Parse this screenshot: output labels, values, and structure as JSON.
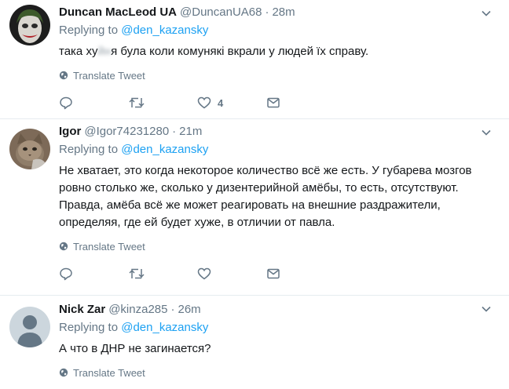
{
  "tweets": [
    {
      "fullname": "Duncan MacLeod UA",
      "handle": "@DuncanUA68",
      "time": "28m",
      "replying_prefix": "Replying to",
      "reply_to": "@den_kazansky",
      "text_before": "така ху",
      "text_hidden": "йн",
      "text_after": "я була коли комунякі вкрали у людей їх справу.",
      "translate": "Translate Tweet",
      "avatar_icon": "joker-avatar",
      "actions": {
        "reply": "",
        "retweet": "",
        "like": "4",
        "dm": ""
      }
    },
    {
      "fullname": "Igor",
      "handle": "@Igor74231280",
      "time": "21m",
      "replying_prefix": "Replying to",
      "reply_to": "@den_kazansky",
      "text": "Не хватает, это когда некоторое количество всё же есть. У губарева мозгов ровно столько же, сколько у дизентерийной амёбы, то есть, отсутствуют. Правда, амёба всё же может реагировать на внешние раздражители, определяя, где ей будет хуже, в отличии от павла.",
      "translate": "Translate Tweet",
      "avatar_icon": "cat-avatar",
      "actions": {
        "reply": "",
        "retweet": "",
        "like": "",
        "dm": ""
      }
    },
    {
      "fullname": "Nick Zar",
      "handle": "@kinza285",
      "time": "26m",
      "replying_prefix": "Replying to",
      "reply_to": "@den_kazansky",
      "text": "А что в ДНР не загинается?",
      "translate": "Translate Tweet",
      "avatar_icon": "default-avatar"
    }
  ],
  "colors": {
    "link": "#1da1f2",
    "secondary": "#657786",
    "text": "#14171a",
    "divider": "#e6ecf0"
  }
}
